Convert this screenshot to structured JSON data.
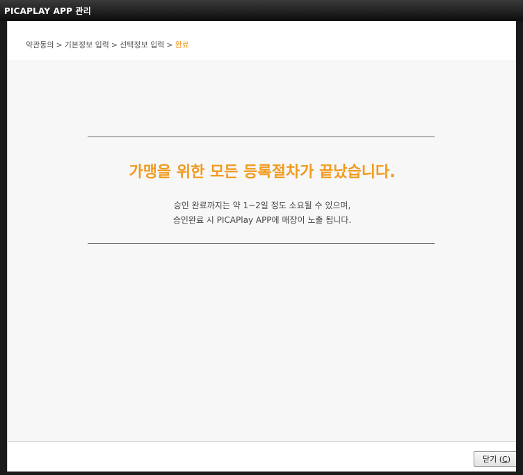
{
  "window": {
    "title": "PICAPLAY APP 관리"
  },
  "breadcrumb": {
    "steps": [
      "약관동의",
      "기본정보 입력",
      "선택정보 입력",
      "완료"
    ],
    "separator": ">"
  },
  "result": {
    "headline": "가맹을 위한 모든 등록절차가 끝났습니다.",
    "message_line1": "승인 완료까지는 약 1~2일 정도 소요될 수 있으며,",
    "message_line2": "승인완료 시 PICAPlay APP에 매장이 노출 됩니다."
  },
  "footer": {
    "close_label": "닫기 (",
    "close_key": "C",
    "close_suffix": ")"
  },
  "colors": {
    "accent": "#f19a1d",
    "titlebar": "#1a1a1a",
    "content_bg": "#f7f7f7"
  }
}
